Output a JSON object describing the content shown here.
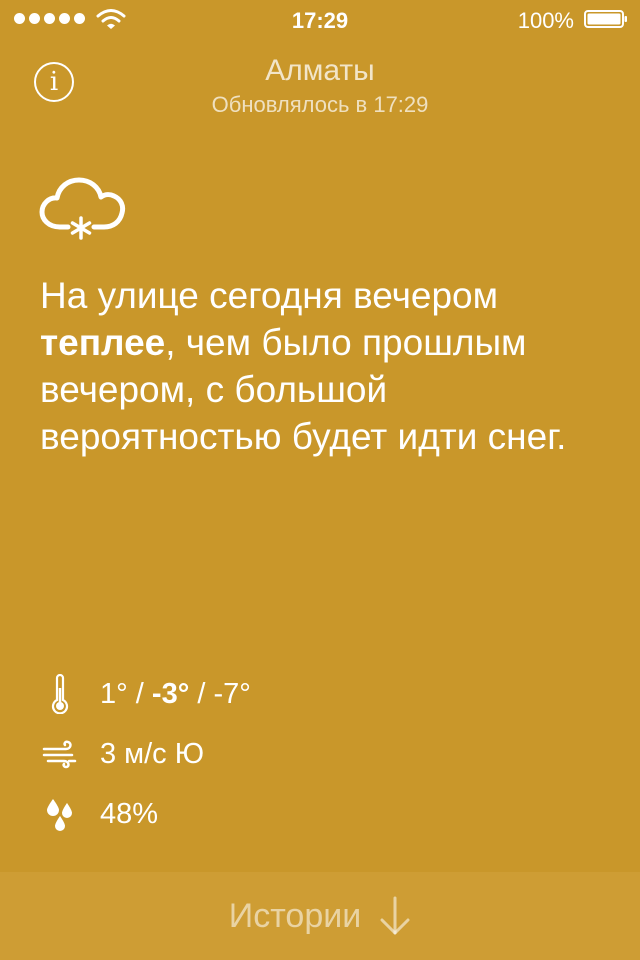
{
  "status_bar": {
    "time": "17:29",
    "battery": "100%"
  },
  "header": {
    "city": "Алматы",
    "updated": "Обновлялось в 17:29",
    "info_glyph": "i"
  },
  "weather": {
    "icon": "cloud-snow-icon",
    "summary_before": "На улице сегодня вечером ",
    "summary_bold": "теплее",
    "summary_after": ", чем было прошлым вечером, с большой вероятностью будет идти снег."
  },
  "stats": {
    "temp_high": "1°",
    "temp_current": "-3°",
    "temp_low": "-7°",
    "separator": " / ",
    "wind": "3 м/с Ю",
    "humidity": "48%"
  },
  "footer": {
    "stories_label": "Истории"
  },
  "colors": {
    "background": "#C9972A",
    "footer": "#CE9D34"
  }
}
